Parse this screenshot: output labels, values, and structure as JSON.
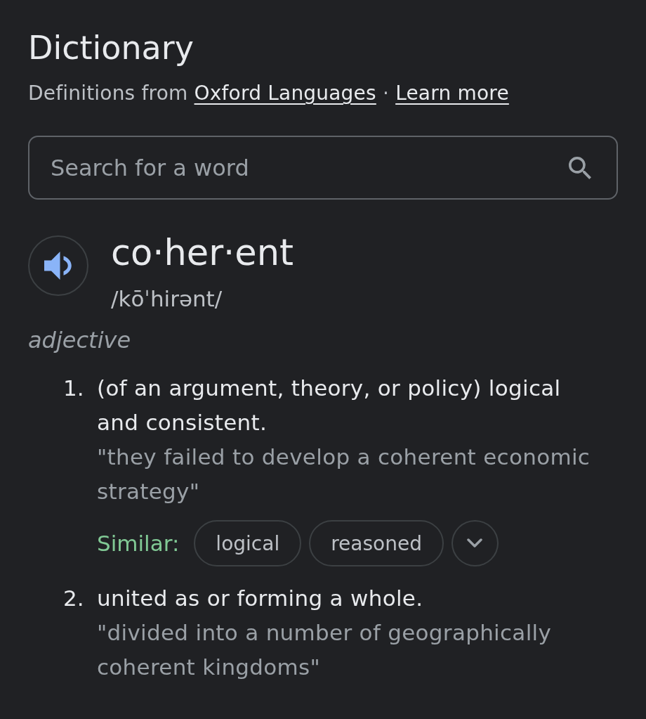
{
  "header": {
    "title": "Dictionary",
    "source": {
      "prefix": "Definitions from",
      "link": "Oxford Languages",
      "separator": "·",
      "learn_more": "Learn more"
    }
  },
  "search": {
    "placeholder": "Search for a word"
  },
  "entry": {
    "word": "co·her·ent",
    "pronunciation": "/kōˈhirənt/",
    "part_of_speech": "adjective",
    "definitions": [
      {
        "number": "1.",
        "text": "(of an argument, theory, or policy) logical and consistent.",
        "example": "\"they failed to develop a coherent economic strategy\"",
        "similar": {
          "label": "Similar:",
          "words": [
            "logical",
            "reasoned"
          ]
        }
      },
      {
        "number": "2.",
        "text": "united as or forming a whole.",
        "example": "\"divided into a number of geographically coherent kingdoms\""
      }
    ]
  }
}
